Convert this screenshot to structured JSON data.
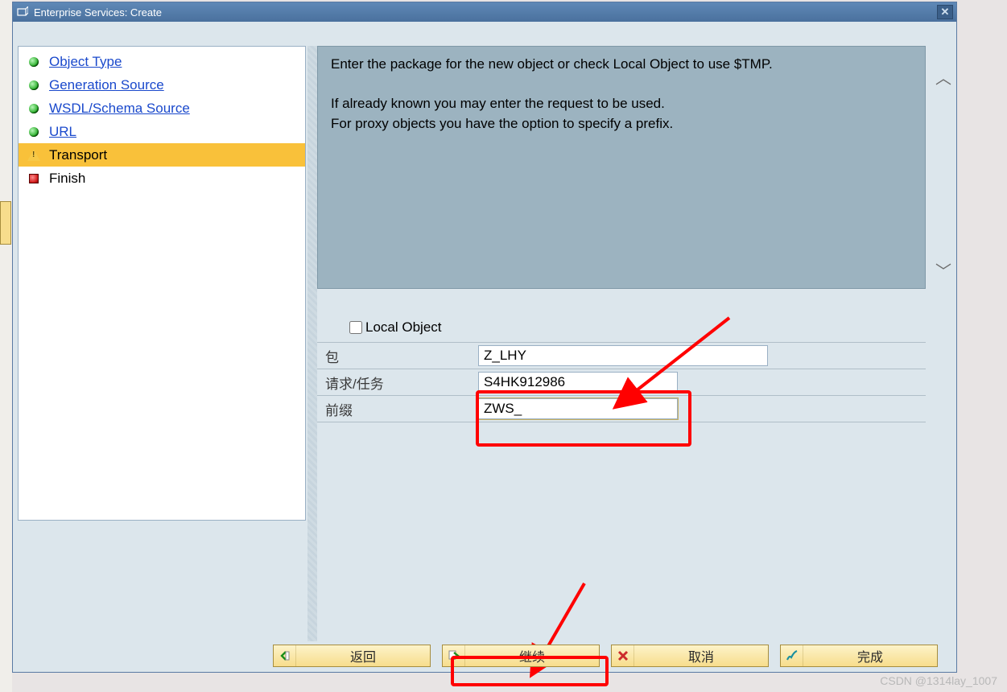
{
  "window": {
    "title": "Enterprise Services: Create"
  },
  "nav": {
    "items": [
      {
        "label": "Object Type",
        "state": "green",
        "link": true,
        "selected": false
      },
      {
        "label": "Generation Source",
        "state": "green",
        "link": true,
        "selected": false
      },
      {
        "label": "WSDL/Schema Source",
        "state": "green",
        "link": true,
        "selected": false
      },
      {
        "label": "URL",
        "state": "green",
        "link": true,
        "selected": false
      },
      {
        "label": "Transport",
        "state": "warn",
        "link": false,
        "selected": true
      },
      {
        "label": "Finish",
        "state": "red",
        "link": false,
        "selected": false
      }
    ]
  },
  "info": {
    "line1": "Enter the package for the new object or check Local Object to use $TMP.",
    "line2": "If already known you may enter the request to be used.",
    "line3": "For proxy objects you have the option to specify a prefix."
  },
  "form": {
    "local_object_label": "Local Object",
    "local_object_checked": false,
    "package_label": "包",
    "package_value": "Z_LHY",
    "request_label": "请求/任务",
    "request_value": "S4HK912986",
    "prefix_label": "前缀",
    "prefix_value": "ZWS_"
  },
  "footer": {
    "back": "返回",
    "continue": "继续",
    "cancel": "取消",
    "complete": "完成"
  },
  "watermark": "CSDN @1314lay_1007"
}
